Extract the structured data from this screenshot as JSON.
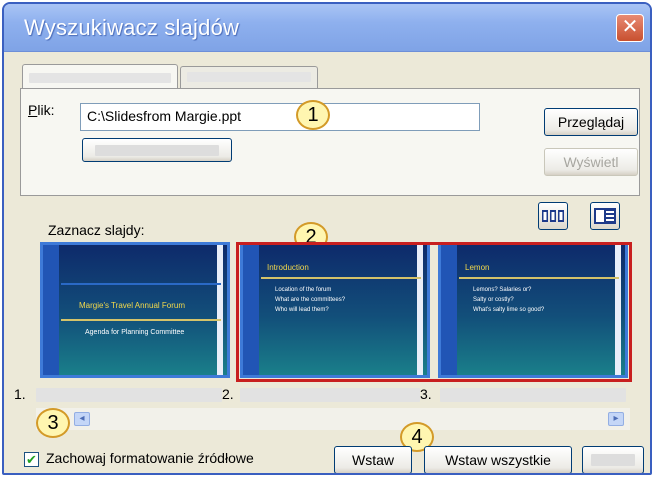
{
  "window": {
    "title": "Wyszukiwacz slajdów",
    "close_glyph": "✕"
  },
  "file": {
    "label": "Plik:",
    "label_mnemonic": "P",
    "label_rest": "lik:",
    "value": "C:\\Slidesfrom Margie.ppt"
  },
  "buttons": {
    "browse": "Przeglądaj",
    "show": "Wyświetl",
    "insert": "Wstaw",
    "insert_all": "Wstaw wszystkie"
  },
  "select_slides": {
    "label": "Zaznacz slajdy:"
  },
  "callouts": [
    "1",
    "2",
    "3",
    "4"
  ],
  "slides": [
    {
      "number": "1.",
      "title": "Margie's Travel Annual Forum",
      "subtitle": "Agenda for Planning Committee",
      "bullets": []
    },
    {
      "number": "2.",
      "title": "Introduction",
      "subtitle": "",
      "bullets": [
        "Location of the forum",
        "What are the committees?",
        "Who will lead them?"
      ]
    },
    {
      "number": "3.",
      "title": "Lemon",
      "subtitle": "",
      "bullets": [
        "Lemons? Salaries or?",
        "Salty or costly?",
        "What's salty lime so good?"
      ]
    }
  ],
  "keep_formatting": {
    "checked": true,
    "check_glyph": "✔",
    "label": "Zachowaj formatowanie źródłowe"
  },
  "icons": {
    "scroll_right": "▸",
    "scroll_left": "◂"
  }
}
